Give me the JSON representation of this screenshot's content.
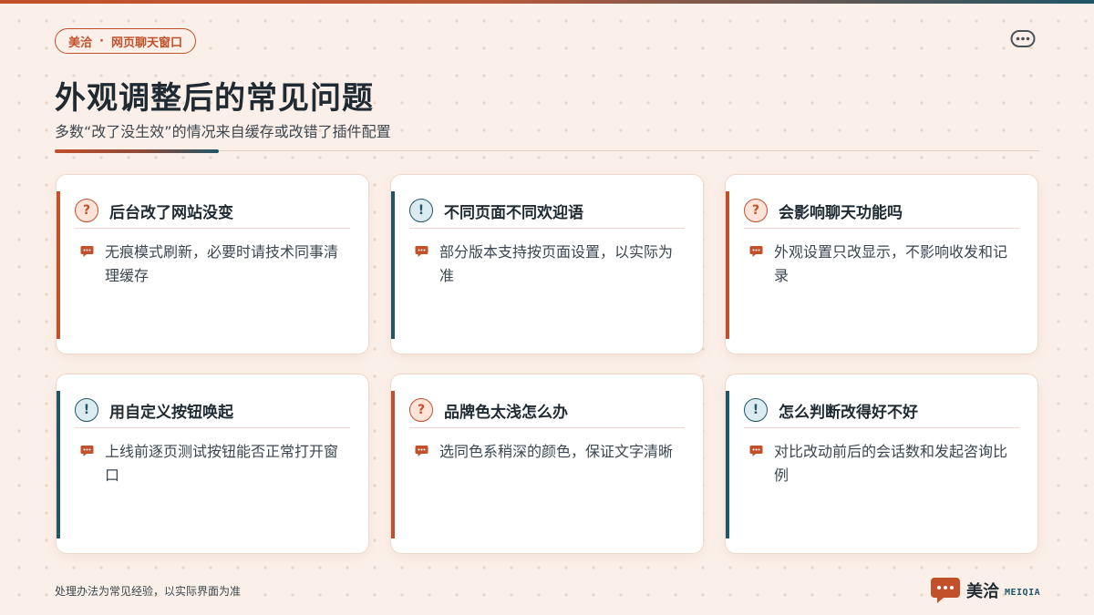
{
  "header": {
    "brand": "美洽",
    "separator": "·",
    "section": "网页聊天窗口",
    "title": "外观调整后的常见问题",
    "subtitle": "多数“改了没生效”的情况来自缓存或改错了插件配置"
  },
  "cards": [
    {
      "icon": "?",
      "icon_type": "question-icon",
      "accent": "#c2502b",
      "title": "后台改了网站没变",
      "text": "无痕模式刷新，必要时请技术同事清理缓存"
    },
    {
      "icon": "!",
      "icon_type": "exclamation-icon",
      "accent": "#1f5668",
      "title": "不同页面不同欢迎语",
      "text": "部分版本支持按页面设置，以实际为准"
    },
    {
      "icon": "?",
      "icon_type": "question-icon",
      "accent": "#c2502b",
      "title": "会影响聊天功能吗",
      "text": "外观设置只改显示，不影响收发和记录"
    },
    {
      "icon": "!",
      "icon_type": "exclamation-icon",
      "accent": "#1f5668",
      "title": "用自定义按钮唤起",
      "text": "上线前逐页测试按钮能否正常打开窗口"
    },
    {
      "icon": "?",
      "icon_type": "question-icon",
      "accent": "#c2502b",
      "title": "品牌色太浅怎么办",
      "text": "选同色系稍深的颜色，保证文字清晰"
    },
    {
      "icon": "!",
      "icon_type": "exclamation-icon",
      "accent": "#1f5668",
      "title": "怎么判断改得好不好",
      "text": "对比改动前后的会话数和发起咨询比例"
    }
  ],
  "footer": {
    "note": "处理办法为常见经验，以实际界面为准",
    "logo_cn": "美洽",
    "logo_en": "MEIQIA"
  },
  "colors": {
    "accent_orange": "#c2502b",
    "accent_teal": "#1f5668",
    "background": "#fbf0e9",
    "text_dark": "#1f2a33"
  }
}
